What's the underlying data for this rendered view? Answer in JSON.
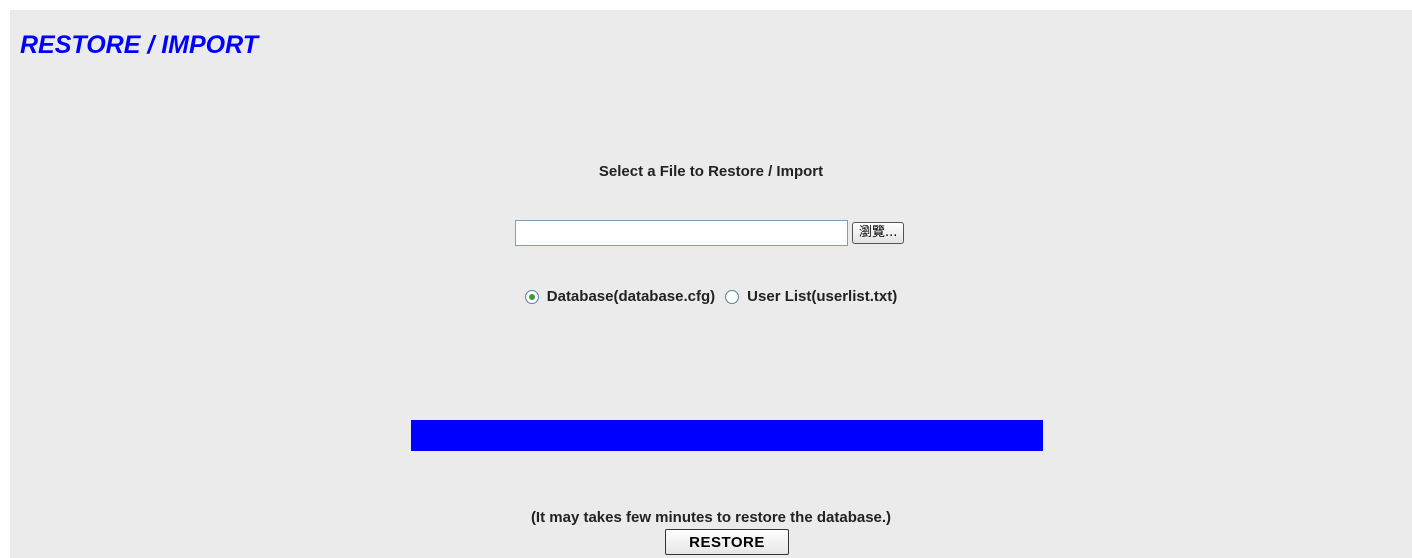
{
  "page": {
    "title": "RESTORE / IMPORT",
    "title_color": "#0000ff",
    "panel_bg": "#ebebeb"
  },
  "file_select": {
    "label": "Select a File to Restore / Import",
    "input_value": "",
    "browse_label": "瀏覽..."
  },
  "restore_type": {
    "options": [
      {
        "label": "Database(database.cfg)",
        "checked": true
      },
      {
        "label": "User List(userlist.txt)",
        "checked": false
      }
    ]
  },
  "progress": {
    "fraction": 1.0,
    "fill_color": "#0000ff"
  },
  "note": "(It may takes few minutes to restore the database.)",
  "restore_button_label": "RESTORE"
}
